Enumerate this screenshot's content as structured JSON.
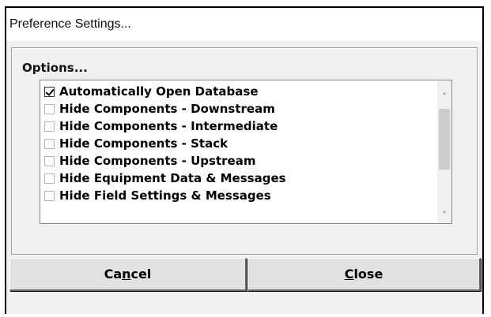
{
  "window": {
    "title": "Preference Settings..."
  },
  "options": {
    "group_label": "Options...",
    "items": [
      {
        "label": "Automatically Open Database",
        "checked": true
      },
      {
        "label": "Hide Components - Downstream",
        "checked": false
      },
      {
        "label": "Hide Components - Intermediate",
        "checked": false
      },
      {
        "label": "Hide Components - Stack",
        "checked": false
      },
      {
        "label": "Hide Components - Upstream",
        "checked": false
      },
      {
        "label": "Hide Equipment Data & Messages",
        "checked": false
      },
      {
        "label": "Hide Field Settings & Messages",
        "checked": false
      }
    ]
  },
  "scrollbar": {
    "up_icon": "chevron-up-icon",
    "down_icon": "chevron-down-icon"
  },
  "buttons": {
    "cancel": {
      "label": "Cancel",
      "prefix": "Ca",
      "mnemonic": "n",
      "suffix": "cel"
    },
    "close": {
      "label": "Close",
      "prefix": "",
      "mnemonic": "C",
      "suffix": "lose"
    }
  },
  "colors": {
    "dialog_bg": "#f0f0f0",
    "list_bg": "#ffffff",
    "button_bg": "#e1e1e1"
  }
}
